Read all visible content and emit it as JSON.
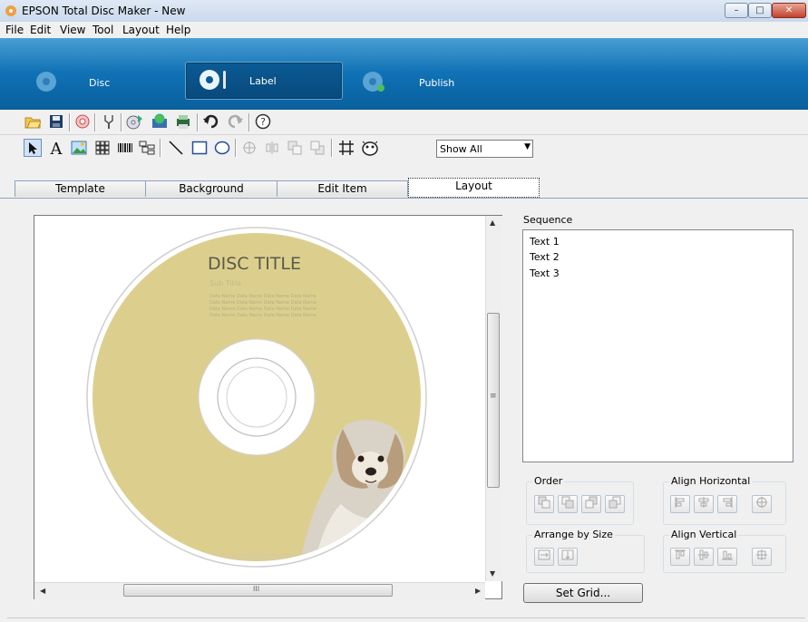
{
  "window": {
    "title": "EPSON Total Disc Maker - New",
    "minimize_label": "–",
    "maximize_label": "□",
    "close_label": "✕"
  },
  "menu": {
    "file": "File",
    "edit": "Edit",
    "view": "View",
    "tool": "Tool",
    "layout": "Layout",
    "help": "Help"
  },
  "nav": {
    "disc": "Disc",
    "label": "Label",
    "publish": "Publish",
    "active": "Label"
  },
  "toolbar2": {
    "view_select": "Show All",
    "view_options": [
      "Show All"
    ]
  },
  "tabs": {
    "template": "Template",
    "background": "Background",
    "edit_item": "Edit Item",
    "layout": "Layout",
    "active": "Layout"
  },
  "disc": {
    "title": "DISC TITLE",
    "subtitle": "Sub Title",
    "data_line": "Data Name Data Name Data Name Data Name",
    "data_lines": [
      "Data Name Data Name Data Name Data Name",
      "Data Name Data Name Data Name Data Name",
      "Data Name Data Name Data Name Data Name",
      "Data Name Data Name Data Name Data Name"
    ]
  },
  "sequence": {
    "label": "Sequence",
    "items": [
      "Text 1",
      "Text 2",
      "Text 3"
    ]
  },
  "groups": {
    "order": "Order",
    "align_horizontal": "Align Horizontal",
    "arrange_by_size": "Arrange by Size",
    "align_vertical": "Align Vertical"
  },
  "buttons": {
    "set_grid": "Set Grid..."
  },
  "scroll": {
    "h_grip": "III",
    "v_grip": "≡"
  },
  "colors": {
    "nav_blue": "#0e6fb2",
    "disc_fill": "#dccf8e",
    "disc_title": "#5a5a48"
  }
}
